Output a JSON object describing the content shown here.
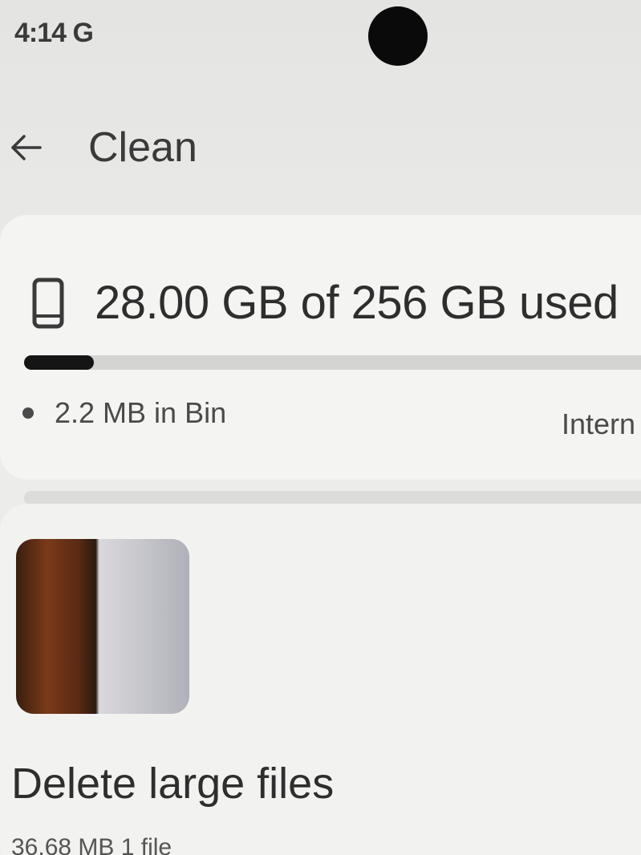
{
  "status_bar": {
    "time": "4:14 G"
  },
  "app_bar": {
    "back_icon": "arrow-back-icon",
    "title": "Clean"
  },
  "storage": {
    "device_icon": "phone-icon",
    "summary": "28.00 GB of 256 GB used",
    "used_fraction": 0.109,
    "bin_text": "2.2 MB in Bin",
    "location_label": "Intern"
  },
  "large_files": {
    "title": "Delete large files",
    "subtitle": "36.68 MB  1 file"
  }
}
